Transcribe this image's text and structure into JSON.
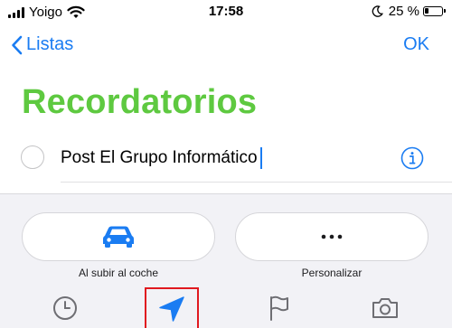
{
  "status_bar": {
    "carrier": "Yoigo",
    "time": "17:58",
    "battery_percent": "25 %",
    "battery_level": 0.25,
    "icons": [
      "signal-icon",
      "wifi-icon",
      "moon-icon",
      "battery-icon"
    ]
  },
  "nav": {
    "back_label": "Listas",
    "done_label": "OK",
    "icons": [
      "chevron-left-icon"
    ]
  },
  "page": {
    "title": "Recordatorios"
  },
  "reminder": {
    "text": "Post El Grupo Informático",
    "icons": [
      "circle-checkbox-icon",
      "info-icon"
    ]
  },
  "toolbar": {
    "options": [
      {
        "label": "Al subir al coche",
        "icon": "car-icon"
      },
      {
        "label": "Personalizar",
        "icon": "ellipsis-icon"
      }
    ],
    "tabs": [
      {
        "icon": "clock-icon"
      },
      {
        "icon": "location-arrow-icon",
        "highlighted": true
      },
      {
        "icon": "flag-icon"
      },
      {
        "icon": "camera-icon"
      }
    ]
  },
  "colors": {
    "accent_blue": "#1a7cf2",
    "title_green": "#5ec940",
    "highlight_red": "#e0191f",
    "toolbar_bg": "#f2f2f6"
  }
}
